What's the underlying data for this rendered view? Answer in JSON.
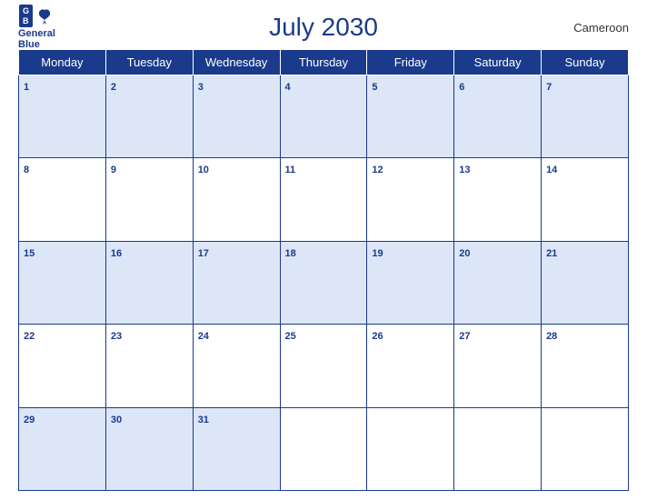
{
  "header": {
    "title": "July 2030",
    "country": "Cameroon",
    "logo": {
      "line1": "General",
      "line2": "Blue"
    }
  },
  "days_of_week": [
    "Monday",
    "Tuesday",
    "Wednesday",
    "Thursday",
    "Friday",
    "Saturday",
    "Sunday"
  ],
  "weeks": [
    [
      1,
      2,
      3,
      4,
      5,
      6,
      7
    ],
    [
      8,
      9,
      10,
      11,
      12,
      13,
      14
    ],
    [
      15,
      16,
      17,
      18,
      19,
      20,
      21
    ],
    [
      22,
      23,
      24,
      25,
      26,
      27,
      28
    ],
    [
      29,
      30,
      31,
      null,
      null,
      null,
      null
    ]
  ]
}
